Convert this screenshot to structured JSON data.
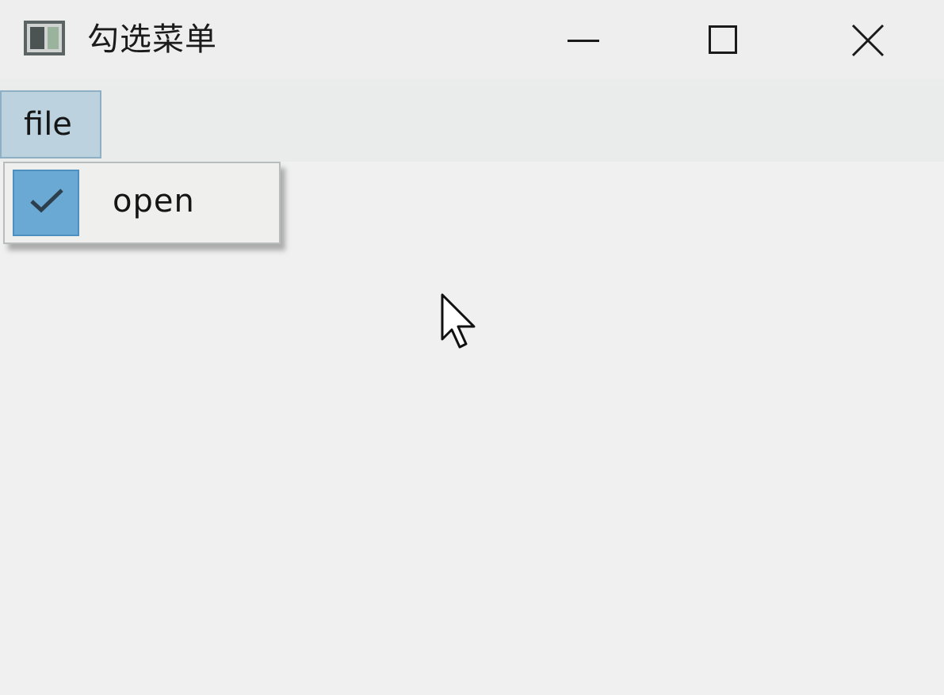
{
  "window": {
    "title": "勾选菜单",
    "controls": {
      "minimize_icon": "minimize-icon",
      "maximize_icon": "maximize-icon",
      "close_icon": "close-icon"
    }
  },
  "menubar": {
    "items": [
      {
        "label": "file",
        "active": true
      }
    ]
  },
  "dropdown": {
    "items": [
      {
        "label": "open",
        "checked": true,
        "icon": "checkmark-icon"
      }
    ]
  },
  "colors": {
    "menu_highlight": "#bcd3df",
    "check_highlight": "#6aa9d3",
    "background": "#eff0ef"
  }
}
